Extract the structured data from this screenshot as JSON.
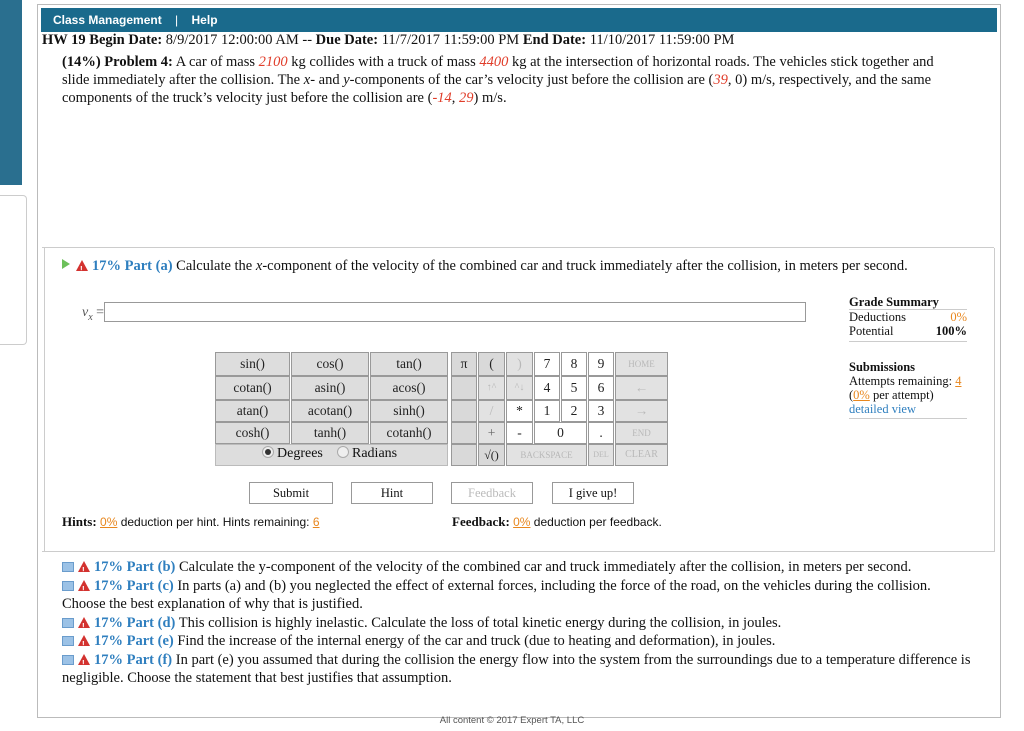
{
  "nav": {
    "class_management": "Class Management",
    "separator": "|",
    "help": "Help"
  },
  "hw": {
    "name": "HW 19",
    "begin_label": "Begin Date:",
    "begin_value": "8/9/2017 12:00:00 AM",
    "due_sep": "--",
    "due_label": "Due Date:",
    "due_value": "11/7/2017 11:59:00 PM",
    "end_label": "End Date:",
    "end_value": "11/10/2017 11:59:00 PM"
  },
  "problem": {
    "heading": "(14%) Problem 4:",
    "t1": "A car of mass ",
    "car_mass": "2100",
    "t2": " kg collides with a truck of mass ",
    "truck_mass": "4400",
    "t3": " kg at the intersection of horizontal roads. The vehicles stick together and slide immediately after the collision. The ",
    "xvar": "x",
    "t4": "- and ",
    "yvar": "y",
    "t5": "-components of the car’s velocity just before the collision are (",
    "car_vx": "39",
    "t6": ", 0) m/s, respectively, and the same components of the truck’s velocity just before the collision are (",
    "truck_vx": "-14",
    "t7": ", ",
    "truck_vy": "29",
    "t8": ") m/s."
  },
  "part_a": {
    "label": "17% Part (a)",
    "text1": " Calculate the ",
    "var": "x",
    "text2": "-component of the velocity of the combined car and truck immediately after the collision, in meters per second.",
    "input_label": "v",
    "input_sub": "x",
    "input_eq": " ="
  },
  "grade_summary": {
    "title": "Grade Summary",
    "deductions_label": "Deductions",
    "deductions_value": "0%",
    "potential_label": "Potential",
    "potential_value": "100%"
  },
  "submissions": {
    "title": "Submissions",
    "attempts_label": "Attempts remaining: ",
    "attempts_value": "4",
    "per_attempt_open": "(",
    "per_attempt_value": "0%",
    "per_attempt_text": " per attempt)",
    "detail_link": "detailed view"
  },
  "calculator": {
    "func_rows": [
      [
        "sin()",
        "cos()",
        "tan()"
      ],
      [
        "cotan()",
        "asin()",
        "acos()"
      ],
      [
        "atan()",
        "acotan()",
        "sinh()"
      ],
      [
        "cosh()",
        "tanh()",
        "cotanh()"
      ]
    ],
    "pi": "π",
    "lparen": "(",
    "rparen": ")",
    "up": "↑^",
    "down": "^↓",
    "slash": "/",
    "star": "*",
    "plus": "+",
    "minus": "-",
    "digits": [
      "7",
      "8",
      "9",
      "4",
      "5",
      "6",
      "1",
      "2",
      "3",
      "0",
      "."
    ],
    "home": "HOME",
    "left": "←",
    "right": "→",
    "end": "END",
    "sqrt": "√()",
    "backspace": "BACKSPACE",
    "del": "DEL",
    "clear": "CLEAR",
    "degrees": "Degrees",
    "radians": "Radians"
  },
  "actions": {
    "submit": "Submit",
    "hint": "Hint",
    "feedback": "Feedback",
    "give_up": "I give up!"
  },
  "hints": {
    "label": "Hints:",
    "pct": "0%",
    "text": " deduction per hint. Hints remaining: ",
    "remaining": "6"
  },
  "feedback": {
    "label": "Feedback:",
    "pct": "0%",
    "text": " deduction per feedback."
  },
  "parts": [
    {
      "label": "17% Part (b)",
      "text": " Calculate the y-component of the velocity of the combined car and truck immediately after the collision, in meters per second."
    },
    {
      "label": "17% Part (c)",
      "text": " In parts (a) and (b) you neglected the effect of external forces, including the force of the road, on the vehicles during the collision. Choose the best explanation of why that is justified."
    },
    {
      "label": "17% Part (d)",
      "text": " This collision is highly inelastic. Calculate the loss of total kinetic energy during the collision, in joules."
    },
    {
      "label": "17% Part (e)",
      "text": " Find the increase of the internal energy of the car and truck (due to heating and deformation), in joules."
    },
    {
      "label": "17% Part (f)",
      "text": " In part (e) you assumed that during the collision the energy flow into the system from the surroundings due to a temperature difference is negligible. Choose the statement that best justifies that assumption."
    }
  ],
  "footer": "All content © 2017 Expert TA, LLC",
  "colors": {
    "nav_bg": "#1a6a8c",
    "accent_red": "#e03d2a",
    "link_blue": "#2f7fbf",
    "orange": "#e8871e"
  }
}
